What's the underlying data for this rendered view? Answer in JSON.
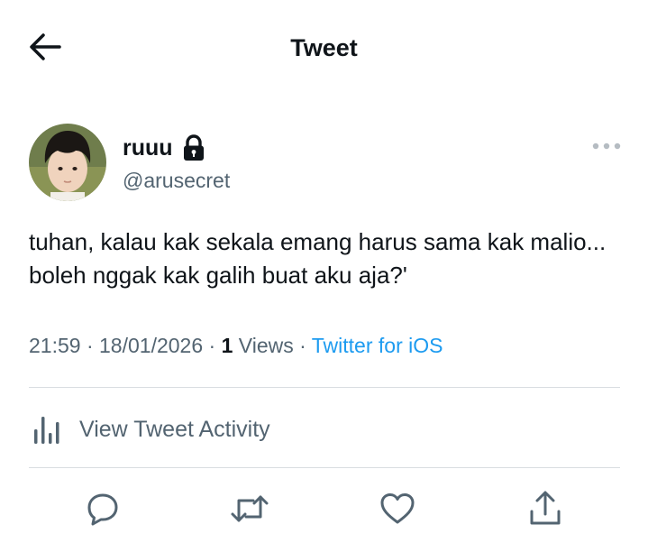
{
  "header": {
    "title": "Tweet",
    "back_icon": "arrow-left-icon"
  },
  "author": {
    "display_name": "ruuu",
    "handle": "@arusecret",
    "protected_icon": "lock-icon",
    "more_icon": "more-horizontal-icon"
  },
  "tweet": {
    "text": "tuhan, kalau kak sekala emang harus sama kak malio... boleh nggak kak galih buat aku aja?'"
  },
  "meta": {
    "time": "21:59",
    "date": "18/01/2026",
    "views_count": "1",
    "views_label": "Views",
    "source": "Twitter for iOS",
    "separator": "·"
  },
  "activity": {
    "label": "View Tweet Activity",
    "icon": "bar-chart-icon"
  },
  "actions": [
    {
      "icon": "reply-icon"
    },
    {
      "icon": "retweet-icon"
    },
    {
      "icon": "like-icon"
    },
    {
      "icon": "share-icon"
    }
  ],
  "colors": {
    "text_primary": "#0f1419",
    "text_secondary": "#536471",
    "link": "#1d9bf0",
    "divider": "#d9dde1"
  }
}
